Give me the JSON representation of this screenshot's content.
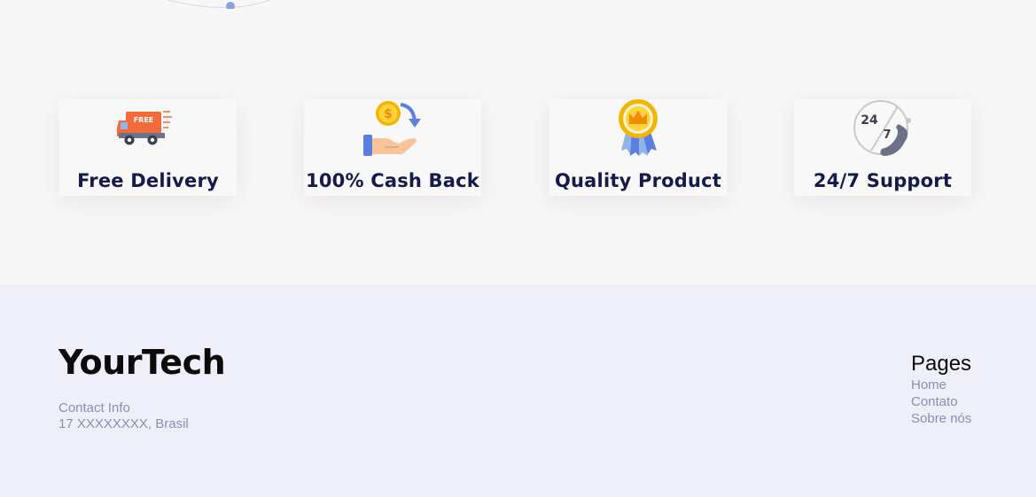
{
  "features": [
    {
      "label": "Free Delivery",
      "icon": "delivery-truck-icon",
      "badge": "FREE"
    },
    {
      "label": "100% Cash Back",
      "icon": "cash-back-icon"
    },
    {
      "label": "Quality Product",
      "icon": "quality-medal-icon"
    },
    {
      "label": "24/7 Support",
      "icon": "support-phone-icon",
      "badge_top": "24",
      "badge_bottom": "7"
    }
  ],
  "footer": {
    "brand": "YourTech",
    "contact_title": "Contact Info",
    "contact_address": "17 XXXXXXXX, Brasil",
    "pages_heading": "Pages",
    "pages_links": [
      "Home",
      "Contato",
      "Sobre nós"
    ]
  },
  "colors": {
    "heading": "#141a4a",
    "muted": "#8a90b5",
    "footer_bg": "#eeeff9",
    "accent_orange": "#f26b3a",
    "accent_blue": "#5b7fe0",
    "accent_gold": "#f5b400"
  }
}
